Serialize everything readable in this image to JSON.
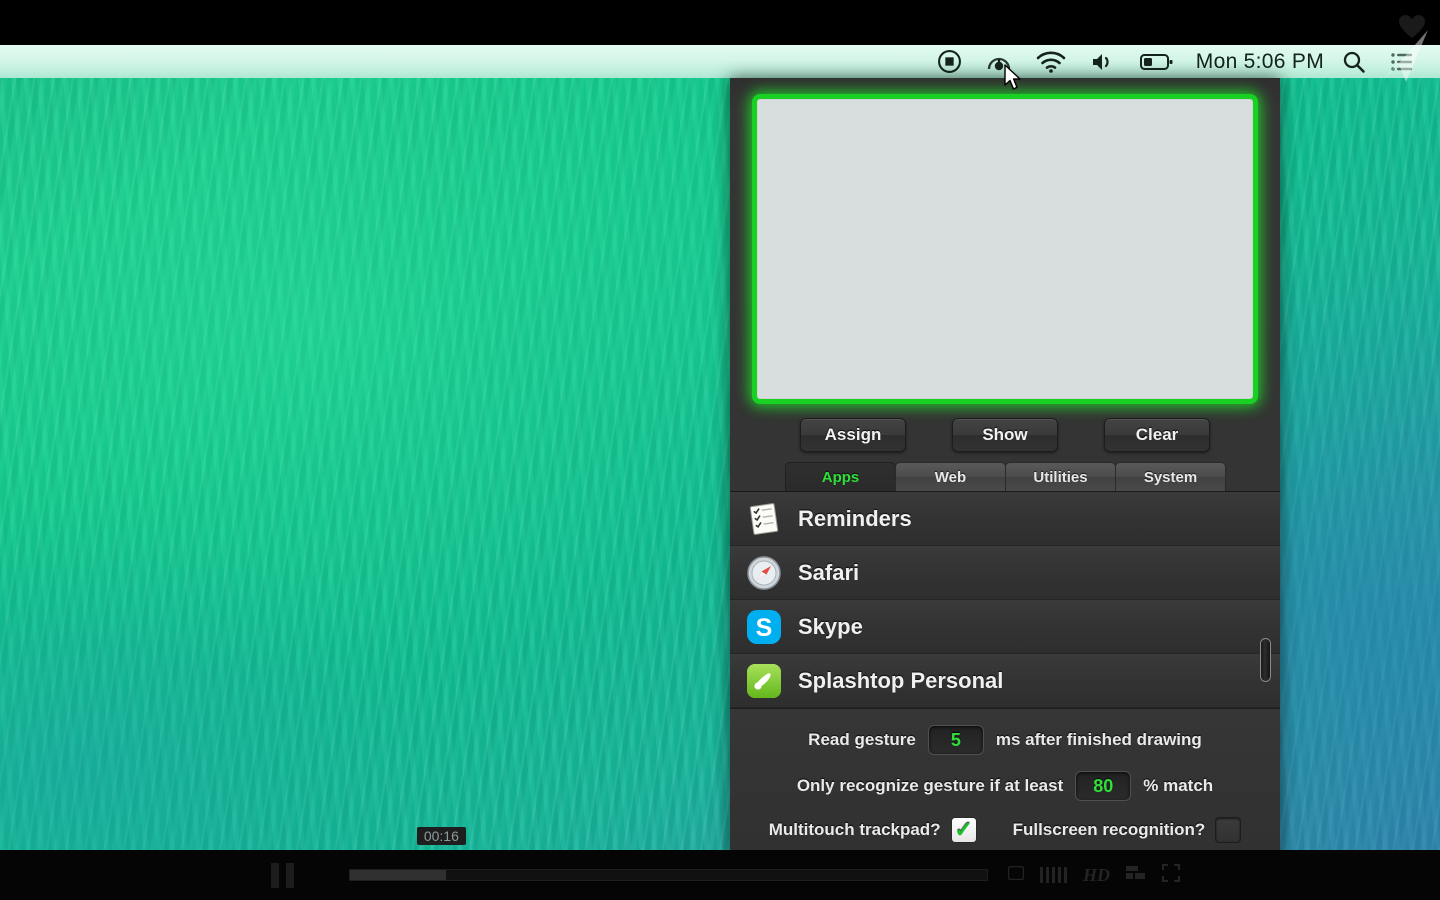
{
  "menubar": {
    "clock": "Mon 5:06 PM",
    "icons": [
      {
        "name": "screen-record-icon",
        "label": "record"
      },
      {
        "name": "gesture-app-icon",
        "label": "gesture"
      },
      {
        "name": "wifi-icon",
        "label": "wifi"
      },
      {
        "name": "volume-icon",
        "label": "volume"
      },
      {
        "name": "battery-icon",
        "label": "battery"
      },
      {
        "name": "spotlight-search-icon",
        "label": "search"
      },
      {
        "name": "notification-center-icon",
        "label": "notifications"
      }
    ]
  },
  "panel": {
    "canvas": {
      "label": "gesture-drawing-canvas",
      "border_color": "#18d122",
      "fill_color": "#d8dedd"
    },
    "buttons": [
      {
        "label": "Assign",
        "name": "assign-button"
      },
      {
        "label": "Show",
        "name": "show-button"
      },
      {
        "label": "Clear",
        "name": "clear-button"
      }
    ],
    "tabs": [
      {
        "label": "Apps",
        "active": true
      },
      {
        "label": "Web",
        "active": false
      },
      {
        "label": "Utilities",
        "active": false
      },
      {
        "label": "System",
        "active": false
      }
    ],
    "active_tab_color": "#2fe03a",
    "apps": [
      {
        "name": "Reminders",
        "icon": "reminders-icon"
      },
      {
        "name": "Safari",
        "icon": "safari-icon"
      },
      {
        "name": "Skype",
        "icon": "skype-icon"
      },
      {
        "name": "Splashtop Personal",
        "icon": "splashtop-icon"
      }
    ],
    "settings": {
      "read_gesture_prefix": "Read gesture",
      "read_gesture_value": "5",
      "read_gesture_suffix": "ms after finished drawing",
      "match_prefix": "Only recognize gesture if at least",
      "match_value": "80",
      "match_suffix": "% match",
      "multitouch_label": "Multitouch trackpad?",
      "multitouch_checked": true,
      "fullscreen_label": "Fullscreen recognition?",
      "fullscreen_checked": false,
      "value_color": "#2fe03a"
    }
  },
  "player": {
    "state": "paused",
    "time_tooltip": "00:16",
    "progress_percent": "15",
    "hd_label": "HD"
  }
}
